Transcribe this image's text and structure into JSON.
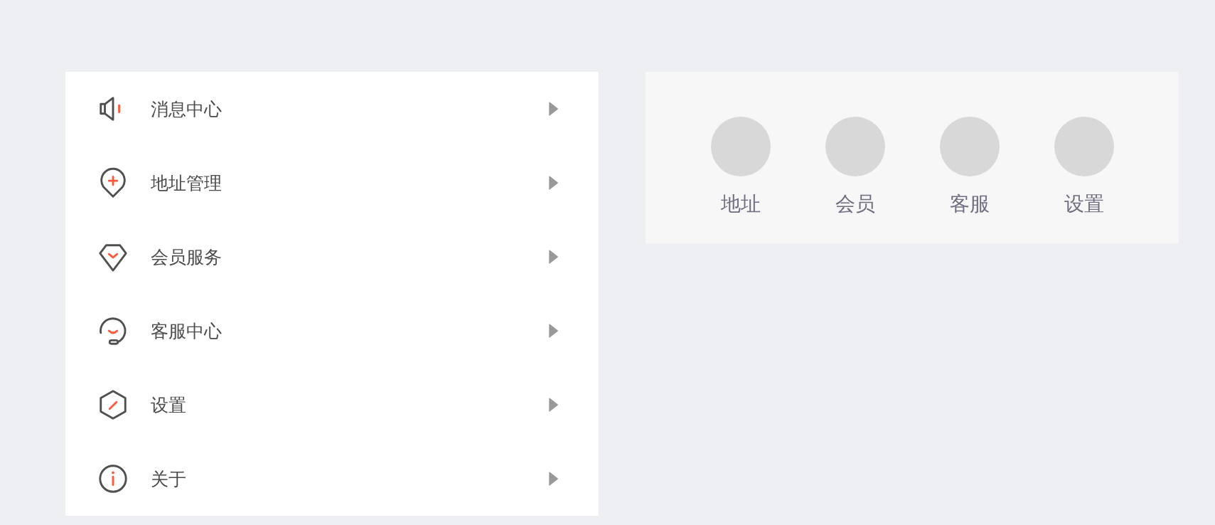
{
  "menu": {
    "items": [
      {
        "kind": "message",
        "label": "消息中心"
      },
      {
        "kind": "address",
        "label": "地址管理"
      },
      {
        "kind": "member",
        "label": "会员服务"
      },
      {
        "kind": "service",
        "label": "客服中心"
      },
      {
        "kind": "settings",
        "label": "设置"
      },
      {
        "kind": "about",
        "label": "关于"
      }
    ]
  },
  "shortcuts": {
    "items": [
      {
        "label": "地址"
      },
      {
        "label": "会员"
      },
      {
        "label": "客服"
      },
      {
        "label": "设置"
      }
    ]
  }
}
